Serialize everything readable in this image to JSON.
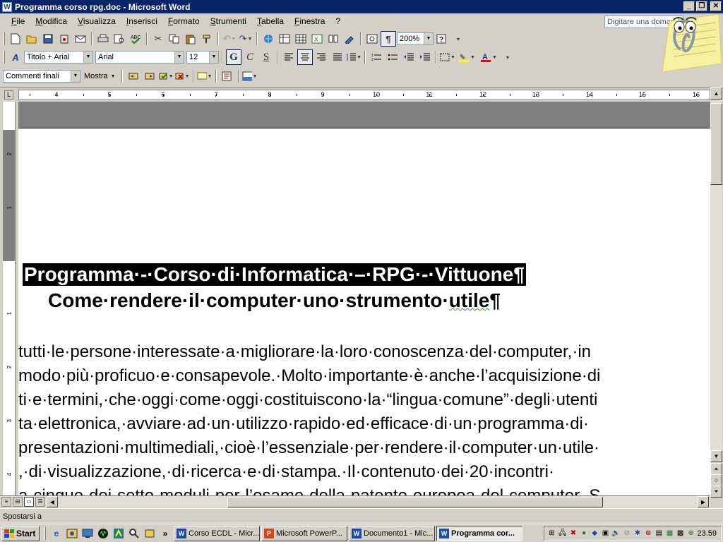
{
  "window": {
    "title": "Programma corso rpg.doc - Microsoft Word",
    "app_icon_letter": "W"
  },
  "menu": {
    "items": [
      "File",
      "Modifica",
      "Visualizza",
      "Inserisci",
      "Formato",
      "Strumenti",
      "Tabella",
      "Finestra",
      "?"
    ]
  },
  "help_box": {
    "placeholder": "Digitare una domanda"
  },
  "standard_toolbar": {
    "zoom": "200%"
  },
  "formatting_toolbar": {
    "style": "Titolo + Arial",
    "font": "Arial",
    "size": "12",
    "bold": "G",
    "italic": "C",
    "underline": "S"
  },
  "review_toolbar": {
    "display_mode": "Commenti finali",
    "show_label": "Mostra"
  },
  "ruler": {
    "numbers": [
      "4",
      "5",
      "6",
      "7",
      "8",
      "9",
      "10",
      "11",
      "12",
      "13",
      "14",
      "15",
      "16"
    ]
  },
  "vruler": {
    "numbers": [
      "2",
      "1",
      "1",
      "2",
      "3",
      "4"
    ]
  },
  "document": {
    "heading1": "Programma·-·Corso·di·Informatica·–·RPG·-·Vittuone¶",
    "heading2_pre": "Come·rendere·il·computer·uno·strumento·",
    "heading2_word": "utile",
    "heading2_post": "¶",
    "lines": [
      "tutti·le·persone·interessate·a·migliorare·la·loro·conoscenza·del·computer,·in",
      "modo·più·proficuo·e·consapevole.·Molto·importante·è·anche·l’acquisizione·di",
      "ti·e·termini,·che·oggi·come·oggi·costituiscono·la·“lingua·comune”·degli·utenti",
      "ta·elettronica,·avviare·ad·un·utilizzo·rapido·ed·efficace·di·un·programma·di·",
      "presentazioni·multimediali,·cioè·l’essenziale·per·rendere·il·computer·un·utile·",
      ",·di·visualizzazione,·di·ricerca·e·di·stampa.·Il·contenuto·dei·20·incontri·",
      "a·cinque·dei·sette·moduli·per·l’esame·della·patente·europea·del·computer.·S"
    ]
  },
  "status": {
    "text": "Spostarsi a"
  },
  "taskbar": {
    "start": "Start",
    "tasks": [
      {
        "label": "Corso ECDL - Micr...",
        "icon": "word-icon"
      },
      {
        "label": "Microsoft PowerP...",
        "icon": "powerpoint-icon"
      },
      {
        "label": "Documento1 - Mic...",
        "icon": "word-icon"
      },
      {
        "label": "Programma cor...",
        "icon": "word-icon",
        "active": true
      }
    ],
    "clock": "23.59"
  },
  "colors": {
    "title_bar": "#0a246a",
    "highlight": "#ffff00",
    "font_color": "#ff0000"
  }
}
